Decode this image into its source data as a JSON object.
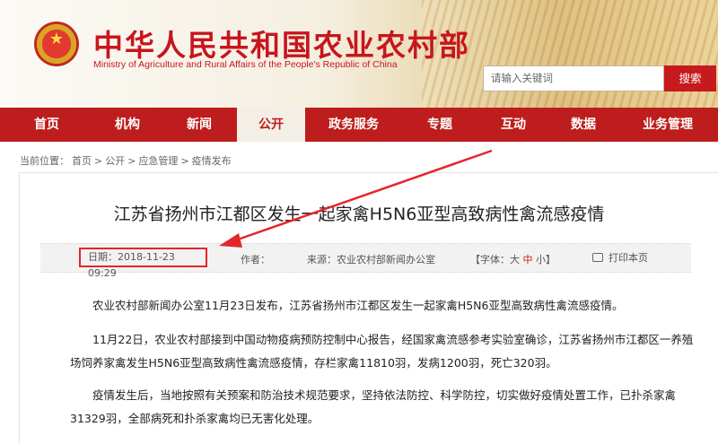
{
  "header": {
    "title": "中华人民共和国农业农村部",
    "subtitle": "Ministry of Agriculture and Rural Affairs of the People's Republic of China",
    "search_placeholder": "请输入关键词",
    "search_button": "搜索",
    "emblem_icon": "national-emblem",
    "brand_color": "#c61a1f"
  },
  "nav": {
    "items": [
      {
        "label": "首页"
      },
      {
        "label": "机构"
      },
      {
        "label": "新闻"
      },
      {
        "label": "公开"
      },
      {
        "label": "政务服务"
      },
      {
        "label": "专题"
      },
      {
        "label": "互动"
      },
      {
        "label": "数据"
      },
      {
        "label": "业务管理"
      }
    ],
    "active": "公开"
  },
  "breadcrumb": {
    "prefix": "当前位置：",
    "items": [
      "首页",
      "公开",
      "应急管理",
      "疫情发布"
    ],
    "separator": ">"
  },
  "article": {
    "title": "江苏省扬州市江都区发生一起家禽H5N6亚型高致病性禽流感疫情",
    "date": "日期：2018-11-23 09:29",
    "author": "作者：",
    "source": "来源：农业农村部新闻办公室",
    "font_label": "【字体：",
    "font_large": "大",
    "font_medium": "中",
    "font_small": "小】",
    "print": "打印本页",
    "paragraphs": [
      "农业农村部新闻办公室11月23日发布，江苏省扬州市江都区发生一起家禽H5N6亚型高致病性禽流感疫情。",
      "11月22日，农业农村部接到中国动物疫病预防控制中心报告，经国家禽流感参考实验室确诊，江苏省扬州市江都区一养殖场饲养家禽发生H5N6亚型高致病性禽流感疫情，存栏家禽11810羽，发病1200羽，死亡320羽。",
      "疫情发生后，当地按照有关预案和防治技术规范要求，坚持依法防控、科学防控，切实做好疫情处置工作，已扑杀家禽31329羽，全部病死和扑杀家禽均已无害化处理。"
    ]
  },
  "annotation": {
    "highlight_color": "#e4262a"
  }
}
